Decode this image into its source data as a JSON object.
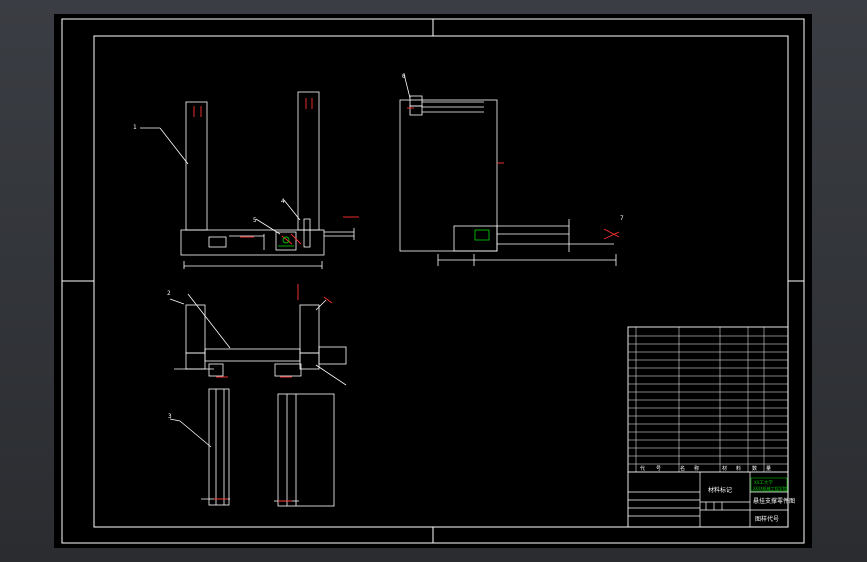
{
  "drawing": {
    "background": "#000000",
    "line_color": "#ffffff",
    "center_color": "#ff3030",
    "accent_green": "#00c000",
    "balloons": [
      "1",
      "2",
      "3",
      "4",
      "5",
      "6",
      "7"
    ]
  },
  "title_block": {
    "drawing_name": "悬挂支撑零件图",
    "material": "材料标记",
    "drawing_code": "图样代号",
    "school": "XX工大学",
    "org_line": "XXXX机械工程学院",
    "header_labels": [
      "代",
      "号",
      "名",
      "称",
      "材",
      "料",
      "数",
      "量"
    ]
  }
}
